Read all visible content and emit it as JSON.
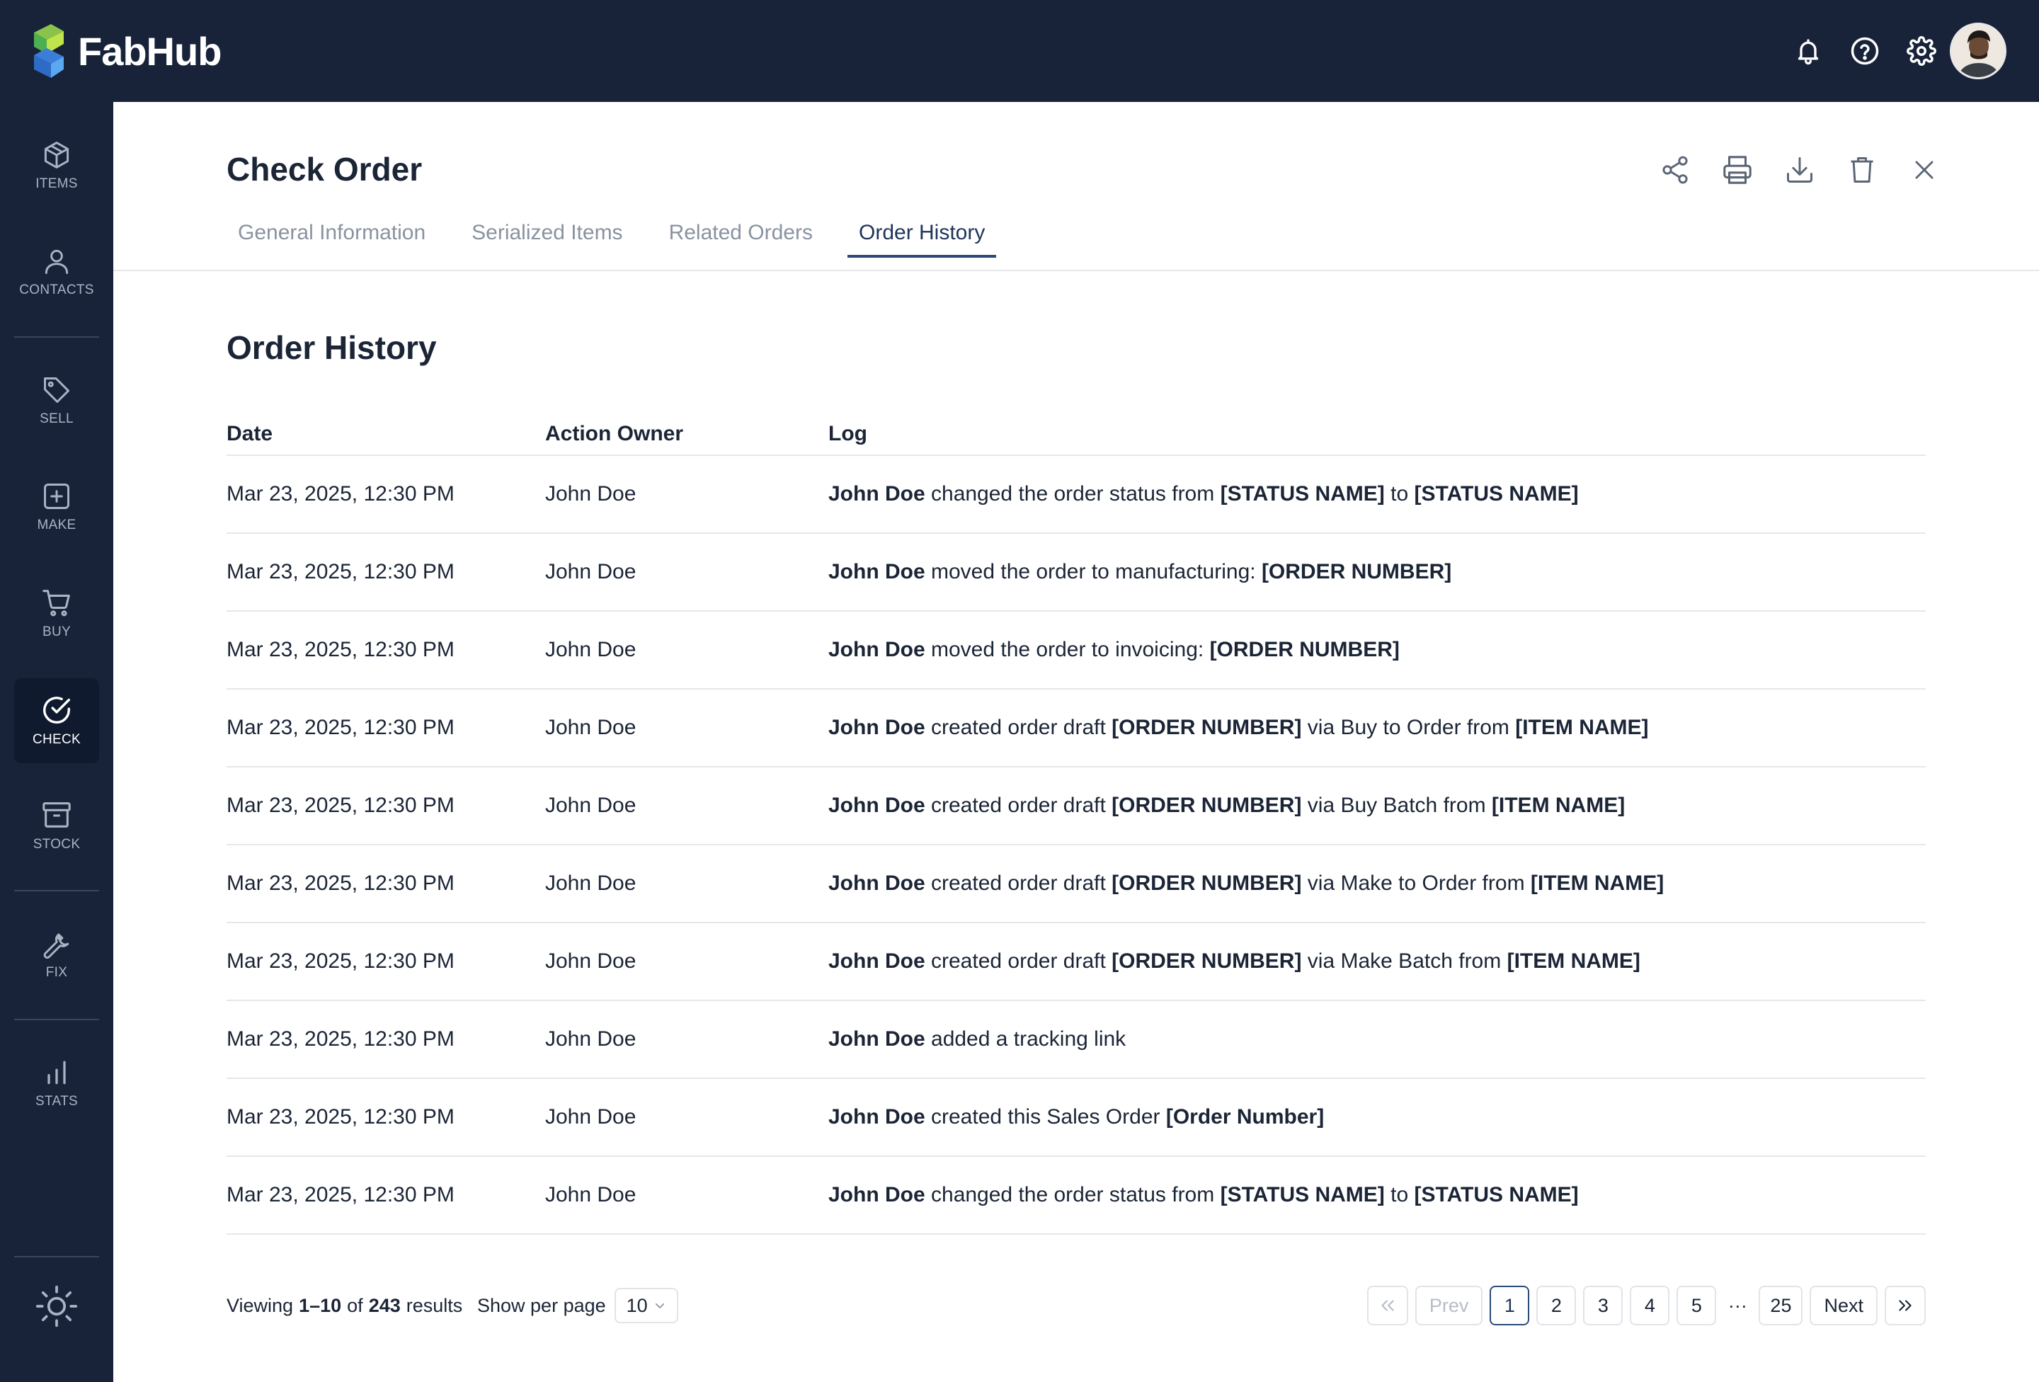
{
  "app": {
    "name": "FabHub"
  },
  "sidebar": {
    "items": [
      {
        "label": "ITEMS",
        "icon": "cube-icon"
      },
      {
        "label": "CONTACTS",
        "icon": "person-icon"
      },
      {
        "label": "SELL",
        "icon": "tag-icon"
      },
      {
        "label": "MAKE",
        "icon": "plus-square-icon"
      },
      {
        "label": "BUY",
        "icon": "cart-icon"
      },
      {
        "label": "CHECK",
        "icon": "check-circle-icon",
        "active": true
      },
      {
        "label": "STOCK",
        "icon": "archive-box-icon"
      },
      {
        "label": "FIX",
        "icon": "wrench-icon"
      },
      {
        "label": "STATS",
        "icon": "bar-chart-icon"
      }
    ]
  },
  "page": {
    "title": "Check Order",
    "tabs": [
      {
        "label": "General Information"
      },
      {
        "label": "Serialized Items"
      },
      {
        "label": "Related Orders"
      },
      {
        "label": "Order History",
        "active": true
      }
    ],
    "section_title": "Order History"
  },
  "table": {
    "headers": {
      "date": "Date",
      "owner": "Action Owner",
      "log": "Log"
    },
    "rows": [
      {
        "date": "Mar 23, 2025, 12:30 PM",
        "owner": "John Doe",
        "log": [
          {
            "b": true,
            "t": "John Doe"
          },
          {
            "t": " changed the order status from "
          },
          {
            "b": true,
            "t": "[STATUS NAME]"
          },
          {
            "t": " to "
          },
          {
            "b": true,
            "t": "[STATUS NAME]"
          }
        ]
      },
      {
        "date": "Mar 23, 2025, 12:30 PM",
        "owner": "John Doe",
        "log": [
          {
            "b": true,
            "t": "John Doe"
          },
          {
            "t": " moved the order to manufacturing: "
          },
          {
            "b": true,
            "t": "[ORDER NUMBER]"
          }
        ]
      },
      {
        "date": "Mar 23, 2025, 12:30 PM",
        "owner": "John Doe",
        "log": [
          {
            "b": true,
            "t": "John Doe"
          },
          {
            "t": " moved the order to invoicing: "
          },
          {
            "b": true,
            "t": "[ORDER NUMBER]"
          }
        ]
      },
      {
        "date": "Mar 23, 2025, 12:30 PM",
        "owner": "John Doe",
        "log": [
          {
            "b": true,
            "t": "John Doe"
          },
          {
            "t": " created order draft "
          },
          {
            "b": true,
            "t": "[ORDER NUMBER]"
          },
          {
            "t": " via Buy to Order from "
          },
          {
            "b": true,
            "t": "[ITEM NAME]"
          }
        ]
      },
      {
        "date": "Mar 23, 2025, 12:30 PM",
        "owner": "John Doe",
        "log": [
          {
            "b": true,
            "t": "John Doe"
          },
          {
            "t": " created order draft "
          },
          {
            "b": true,
            "t": "[ORDER NUMBER]"
          },
          {
            "t": " via Buy Batch from "
          },
          {
            "b": true,
            "t": "[ITEM NAME]"
          }
        ]
      },
      {
        "date": "Mar 23, 2025, 12:30 PM",
        "owner": "John Doe",
        "log": [
          {
            "b": true,
            "t": "John Doe"
          },
          {
            "t": " created order draft "
          },
          {
            "b": true,
            "t": "[ORDER NUMBER]"
          },
          {
            "t": " via Make to Order from "
          },
          {
            "b": true,
            "t": "[ITEM NAME]"
          }
        ]
      },
      {
        "date": "Mar 23, 2025, 12:30 PM",
        "owner": "John Doe",
        "log": [
          {
            "b": true,
            "t": "John Doe"
          },
          {
            "t": " created order draft "
          },
          {
            "b": true,
            "t": "[ORDER NUMBER]"
          },
          {
            "t": " via Make Batch from "
          },
          {
            "b": true,
            "t": "[ITEM NAME]"
          }
        ]
      },
      {
        "date": "Mar 23, 2025, 12:30 PM",
        "owner": "John Doe",
        "log": [
          {
            "b": true,
            "t": "John Doe"
          },
          {
            "t": " added a tracking link"
          }
        ]
      },
      {
        "date": "Mar 23, 2025, 12:30 PM",
        "owner": "John Doe",
        "log": [
          {
            "b": true,
            "t": "John Doe"
          },
          {
            "t": " created this Sales Order "
          },
          {
            "b": true,
            "t": "[Order Number]"
          }
        ]
      },
      {
        "date": "Mar 23, 2025, 12:30 PM",
        "owner": "John Doe",
        "log": [
          {
            "b": true,
            "t": "John Doe"
          },
          {
            "t": " changed the order status from "
          },
          {
            "b": true,
            "t": "[STATUS NAME]"
          },
          {
            "t": " to "
          },
          {
            "b": true,
            "t": "[STATUS NAME]"
          }
        ]
      }
    ]
  },
  "footer": {
    "viewing_prefix": "Viewing",
    "range": "1–10",
    "of_text": "of",
    "total": "243",
    "results_text": "results",
    "per_page_label": "Show per page",
    "per_page_value": "10",
    "pagination": {
      "first": "«",
      "prev": "Prev",
      "pages": [
        "1",
        "2",
        "3",
        "4",
        "5"
      ],
      "current": "1",
      "ellipsis": "···",
      "last_page": "25",
      "next": "Next",
      "last": "»"
    }
  },
  "colors": {
    "nav_bg": "#18233a",
    "accent": "#2b4a7a",
    "text": "#1b2536",
    "muted": "#8a92a0",
    "border": "#e5e7eb"
  }
}
